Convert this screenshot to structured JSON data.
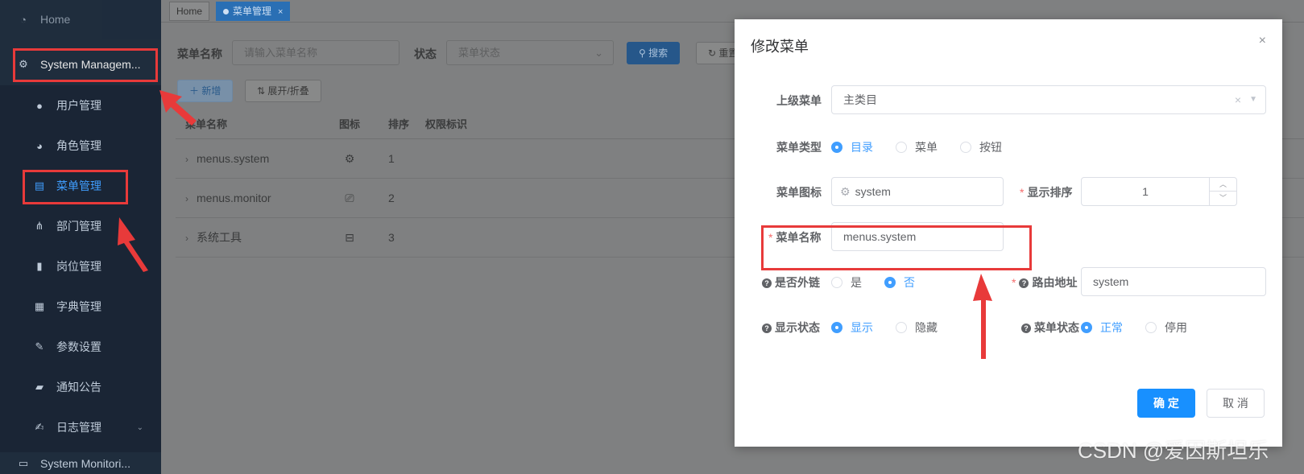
{
  "sidebar": {
    "home": "Home",
    "system": "System Managem...",
    "items": [
      {
        "label": "用户管理",
        "icon": "user-icon"
      },
      {
        "label": "角色管理",
        "icon": "peoples-icon"
      },
      {
        "label": "菜单管理",
        "icon": "tree-table-icon"
      },
      {
        "label": "部门管理",
        "icon": "tree-icon"
      },
      {
        "label": "岗位管理",
        "icon": "post-icon"
      },
      {
        "label": "字典管理",
        "icon": "dict-icon"
      },
      {
        "label": "参数设置",
        "icon": "edit-icon"
      },
      {
        "label": "通知公告",
        "icon": "message-icon"
      },
      {
        "label": "日志管理",
        "icon": "log-icon"
      }
    ],
    "bottom": "System Monitori..."
  },
  "tags": {
    "home": "Home",
    "menu": "菜单管理",
    "close": "×"
  },
  "query": {
    "name_label": "菜单名称",
    "name_placeholder": "请输入菜单名称",
    "status_label": "状态",
    "status_placeholder": "菜单状态",
    "search": "搜索",
    "reset": "重置",
    "add": "新增",
    "expand": "展开/折叠"
  },
  "table": {
    "headers": [
      "菜单名称",
      "图标",
      "排序",
      "权限标识"
    ],
    "rows": [
      {
        "name": "menus.system",
        "icon": "gear-icon",
        "order": "1"
      },
      {
        "name": "menus.monitor",
        "icon": "monitor-icon",
        "order": "2"
      },
      {
        "name": "系统工具",
        "icon": "toolbox-icon",
        "order": "3"
      }
    ]
  },
  "dialog": {
    "title": "修改菜单",
    "close": "×",
    "parent_label": "上级菜单",
    "parent_value": "主类目",
    "type_label": "菜单类型",
    "type_options": [
      "目录",
      "菜单",
      "按钮"
    ],
    "type_selected": 0,
    "icon_label": "菜单图标",
    "icon_value": "system",
    "order_label": "显示排序",
    "order_value": "1",
    "name_label": "菜单名称",
    "name_value": "menus.system",
    "external_label": "是否外链",
    "external_options": [
      "是",
      "否"
    ],
    "external_selected": 1,
    "route_label": "路由地址",
    "route_value": "system",
    "visible_label": "显示状态",
    "visible_options": [
      "显示",
      "隐藏"
    ],
    "visible_selected": 0,
    "status_label": "菜单状态",
    "status_options": [
      "正常",
      "停用"
    ],
    "status_selected": 0,
    "ok": "确 定",
    "cancel": "取 消"
  },
  "watermark": "CSDN @爱因斯坦乐",
  "colors": {
    "accent": "#409eff",
    "annotation": "#e83a3a",
    "sidebar": "#1f2d3d"
  }
}
